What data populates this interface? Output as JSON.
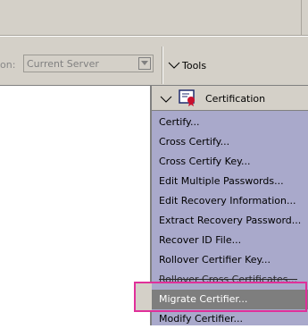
{
  "toolbar": {
    "location_label": "on:",
    "server_select_value": "Current Server",
    "tools_label": "Tools"
  },
  "panel": {
    "title": "Certification",
    "items": [
      {
        "label": "Certify..."
      },
      {
        "label": "Cross Certify..."
      },
      {
        "label": "Cross Certify Key..."
      },
      {
        "label": "Edit Multiple Passwords..."
      },
      {
        "label": "Edit Recovery Information..."
      },
      {
        "label": "Extract Recovery Password..."
      },
      {
        "label": "Recover ID File..."
      },
      {
        "label": "Rollover Certifier Key..."
      },
      {
        "label": "Rollover Cross Certificates..."
      },
      {
        "label": "Migrate Certifier..."
      },
      {
        "label": "Modify Certifier..."
      }
    ],
    "selected_index": 9
  },
  "colors": {
    "panel_bg": "#a9a9cb",
    "selected_bg": "#7e7e7e",
    "highlight_border": "#e0309a"
  }
}
